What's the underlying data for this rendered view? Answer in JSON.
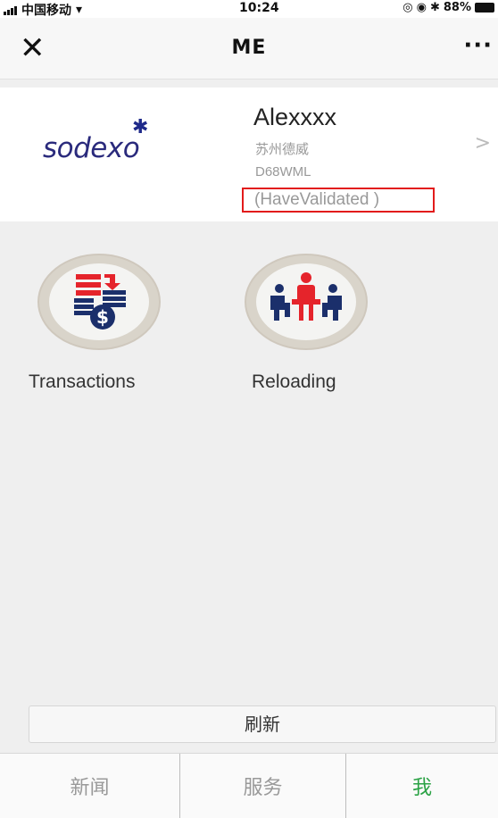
{
  "status_bar": {
    "carrier": "中国移动",
    "time": "10:24",
    "battery": "88%"
  },
  "nav": {
    "title": "ME",
    "close_icon": "close-icon",
    "more_icon": "more-icon"
  },
  "profile": {
    "logo_text": "sodexo",
    "name": "Alexxxx",
    "company": "苏州德威",
    "code": "D68WML",
    "status": "(HaveValidated )"
  },
  "tiles": [
    {
      "label": "Transactions",
      "icon": "transactions-icon"
    },
    {
      "label": "Reloading",
      "icon": "reloading-icon"
    }
  ],
  "refresh_label": "刷新",
  "tabs": [
    {
      "label": "新闻",
      "active": false
    },
    {
      "label": "服务",
      "active": false
    },
    {
      "label": "我",
      "active": true
    }
  ],
  "colors": {
    "accent_green": "#2ba245",
    "highlight_red": "#e21b1b",
    "brand_navy": "#2a2a7c"
  }
}
